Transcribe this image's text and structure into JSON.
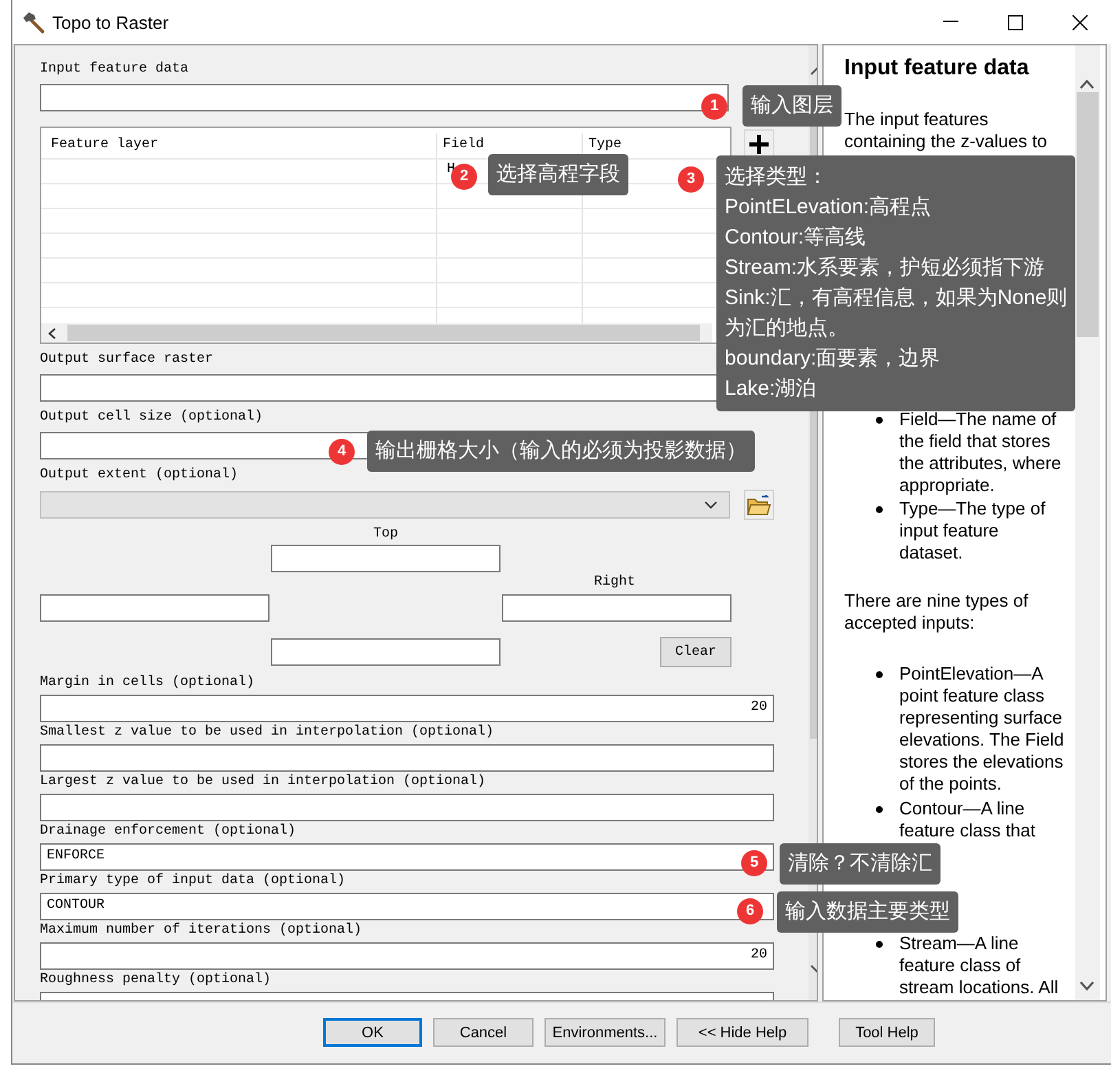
{
  "window": {
    "title": "Topo to Raster"
  },
  "input_feature_data": {
    "label": "Input feature data"
  },
  "feature_table": {
    "columns": [
      "Feature layer",
      "Field",
      "Type"
    ],
    "rows": [
      {
        "field": "H"
      }
    ]
  },
  "parameters": [
    {
      "kind": "text",
      "label": "Output surface raster"
    },
    {
      "kind": "text",
      "label": "Output cell size (optional)"
    },
    {
      "kind": "combo",
      "label": "Output extent (optional)",
      "disabled": true
    },
    {
      "kind": "extent",
      "top_label": "Top",
      "right_label": "Right",
      "clear_button": "Clear"
    },
    {
      "kind": "number",
      "label": "Margin in cells (optional)",
      "value": "20"
    },
    {
      "kind": "text",
      "label": "Smallest z value to be used in interpolation (optional)"
    },
    {
      "kind": "text",
      "label": "Largest z value to be used in interpolation (optional)"
    },
    {
      "kind": "text",
      "label": "Drainage enforcement (optional)",
      "value": "ENFORCE"
    },
    {
      "kind": "text",
      "label": "Primary type of input data (optional)",
      "value": "CONTOUR"
    },
    {
      "kind": "number",
      "label": "Maximum number of iterations (optional)",
      "value": "20"
    },
    {
      "kind": "text",
      "label": "Roughness penalty (optional)"
    }
  ],
  "help": {
    "title": "Input feature data",
    "blocks": [
      {
        "kind": "paragraph",
        "text": "The input features containing the z-values to"
      },
      {
        "kind": "bullet",
        "text": "Field—The name of the field that stores the attributes, where appropriate."
      },
      {
        "kind": "bullet",
        "text": "Type—The type of input feature dataset."
      },
      {
        "kind": "paragraph",
        "text": "There are nine types of accepted inputs:"
      },
      {
        "kind": "bullet",
        "text": "PointElevation—A point feature class representing surface elevations. The Field stores the elevations of the points."
      },
      {
        "kind": "bullet",
        "text": "Contour—A line feature class that"
      },
      {
        "kind": "bullet",
        "text": "Stream—A line feature class of stream locations. All"
      }
    ]
  },
  "buttons": [
    {
      "label": "OK",
      "default": true
    },
    {
      "label": "Cancel",
      "default": false
    },
    {
      "label": "Environments...",
      "default": false
    },
    {
      "label": "<< Hide Help",
      "default": false
    }
  ],
  "tool_help_button": "Tool Help",
  "annotations": [
    {
      "number": "1",
      "lines": [
        "输入图层"
      ]
    },
    {
      "number": "2",
      "lines": [
        "选择高程字段"
      ]
    },
    {
      "number": "3",
      "lines": [
        "选择类型：",
        "PointELevation:高程点",
        "Contour:等高线",
        "Stream:水系要素，护短必须指下游",
        "Sink:汇，有高程信息，如果为None则",
        "为汇的地点。",
        "boundary:面要素，边界",
        "Lake:湖泊"
      ]
    },
    {
      "number": "4",
      "lines": [
        "输出栅格大小（输入的必须为投影数据）"
      ]
    },
    {
      "number": "5",
      "lines": [
        "清除？不清除汇"
      ]
    },
    {
      "number": "6",
      "lines": [
        "输入数据主要类型"
      ]
    }
  ]
}
